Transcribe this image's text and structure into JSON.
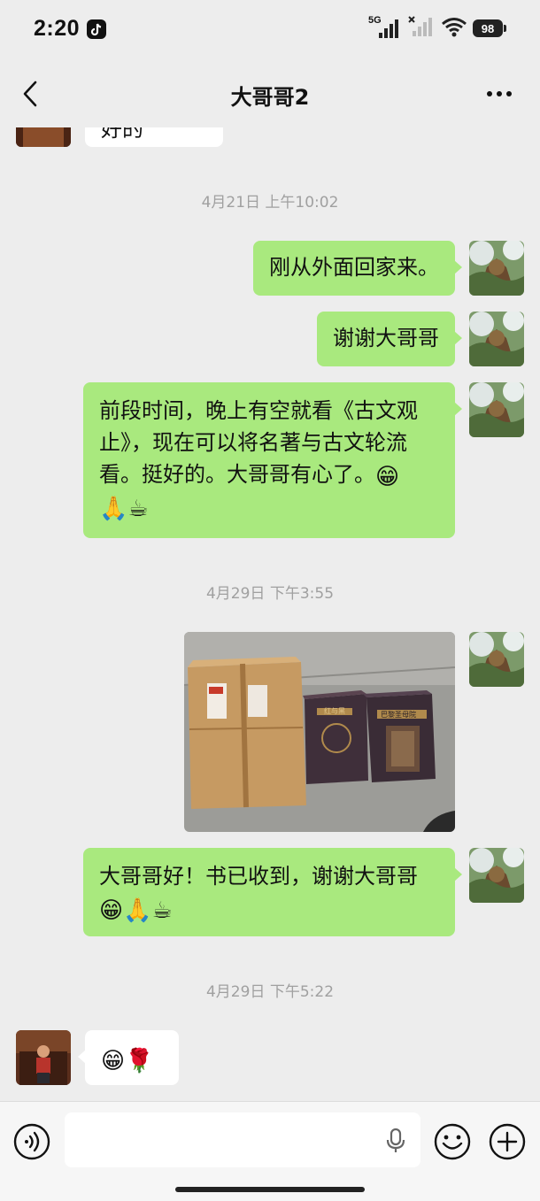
{
  "status_bar": {
    "time": "2:20",
    "network": "5G",
    "battery": "98"
  },
  "header": {
    "title": "大哥哥2"
  },
  "messages": {
    "top_partial_text": "好的",
    "timestamps": [
      "4月21日 上午10:02",
      "4月29日 下午3:55",
      "4月29日 下午5:22"
    ],
    "out_1": "刚从外面回家来。",
    "out_2": "谢谢大哥哥",
    "out_3_line_1": "前段时间，晚上有空就看《古文观",
    "out_3_line_2": "止》，现在可以将名著与古文轮流",
    "out_3_line_3": "看。挺好的。大哥哥有心了。",
    "out_5_line_1": "大哥哥好！书已收到，谢谢大哥哥",
    "book_titles": [
      "红与黑",
      "巴黎圣母院"
    ],
    "emojis": {
      "grin": "😁",
      "pray": "🙏",
      "coffee": "☕",
      "rose": "🌹"
    }
  },
  "input": {
    "placeholder": ""
  },
  "colors": {
    "background": "#ededed",
    "outgoing_bubble": "#a9e97e",
    "incoming_bubble": "#ffffff",
    "timestamp_text": "#a0a0a0"
  },
  "icons": [
    "back-arrow-icon",
    "more-dots-icon",
    "voice-icon",
    "mic-icon",
    "emoji-face-icon",
    "plus-circle-icon"
  ]
}
